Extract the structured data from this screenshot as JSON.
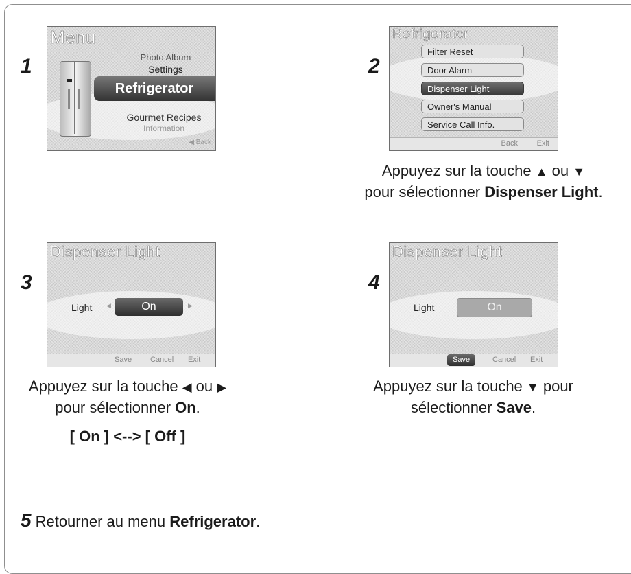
{
  "steps": {
    "s1": {
      "number": "1",
      "title": "Menu",
      "items": [
        "Photo Album",
        "Settings",
        "Refrigerator",
        "Gourmet Recipes",
        "Information"
      ],
      "back": "◀ Back"
    },
    "s2": {
      "number": "2",
      "title": "Refrigerator",
      "items": [
        "Filter Reset",
        "Door Alarm",
        "Dispenser Light",
        "Owner's Manual",
        "Service Call Info."
      ],
      "back": "Back",
      "exit": "Exit",
      "caption_line1_pre": "Appuyez sur la touche ",
      "caption_up": "▲",
      "caption_ou": " ou ",
      "caption_down": "▼",
      "caption_line2_pre": "pour sélectionner ",
      "caption_line2_bold": "Dispenser Light",
      "caption_line2_post": "."
    },
    "s3": {
      "number": "3",
      "title": "Dispenser Light",
      "label": "Light",
      "value": "On",
      "save": "Save",
      "cancel": "Cancel",
      "exit": "Exit",
      "caption_line1_pre": "Appuyez sur la touche ",
      "caption_left": "◀",
      "caption_ou": " ou ",
      "caption_right": "▶",
      "caption_line2_pre": "pour sélectionner ",
      "caption_line2_bold": "On",
      "caption_line2_post": ".",
      "toggle": "[ On ] <--> [ Off ]"
    },
    "s4": {
      "number": "4",
      "title": "Dispenser Light",
      "label": "Light",
      "value": "On",
      "save": "Save",
      "cancel": "Cancel",
      "exit": "Exit",
      "caption_line1_pre": "Appuyez sur la touche ",
      "caption_down": "▼",
      "caption_line1_post": " pour",
      "caption_line2_pre": "sélectionner ",
      "caption_line2_bold": "Save",
      "caption_line2_post": "."
    },
    "s5": {
      "number": "5",
      "text_pre": "Retourner au menu ",
      "text_bold": "Refrigerator",
      "text_post": "."
    }
  }
}
